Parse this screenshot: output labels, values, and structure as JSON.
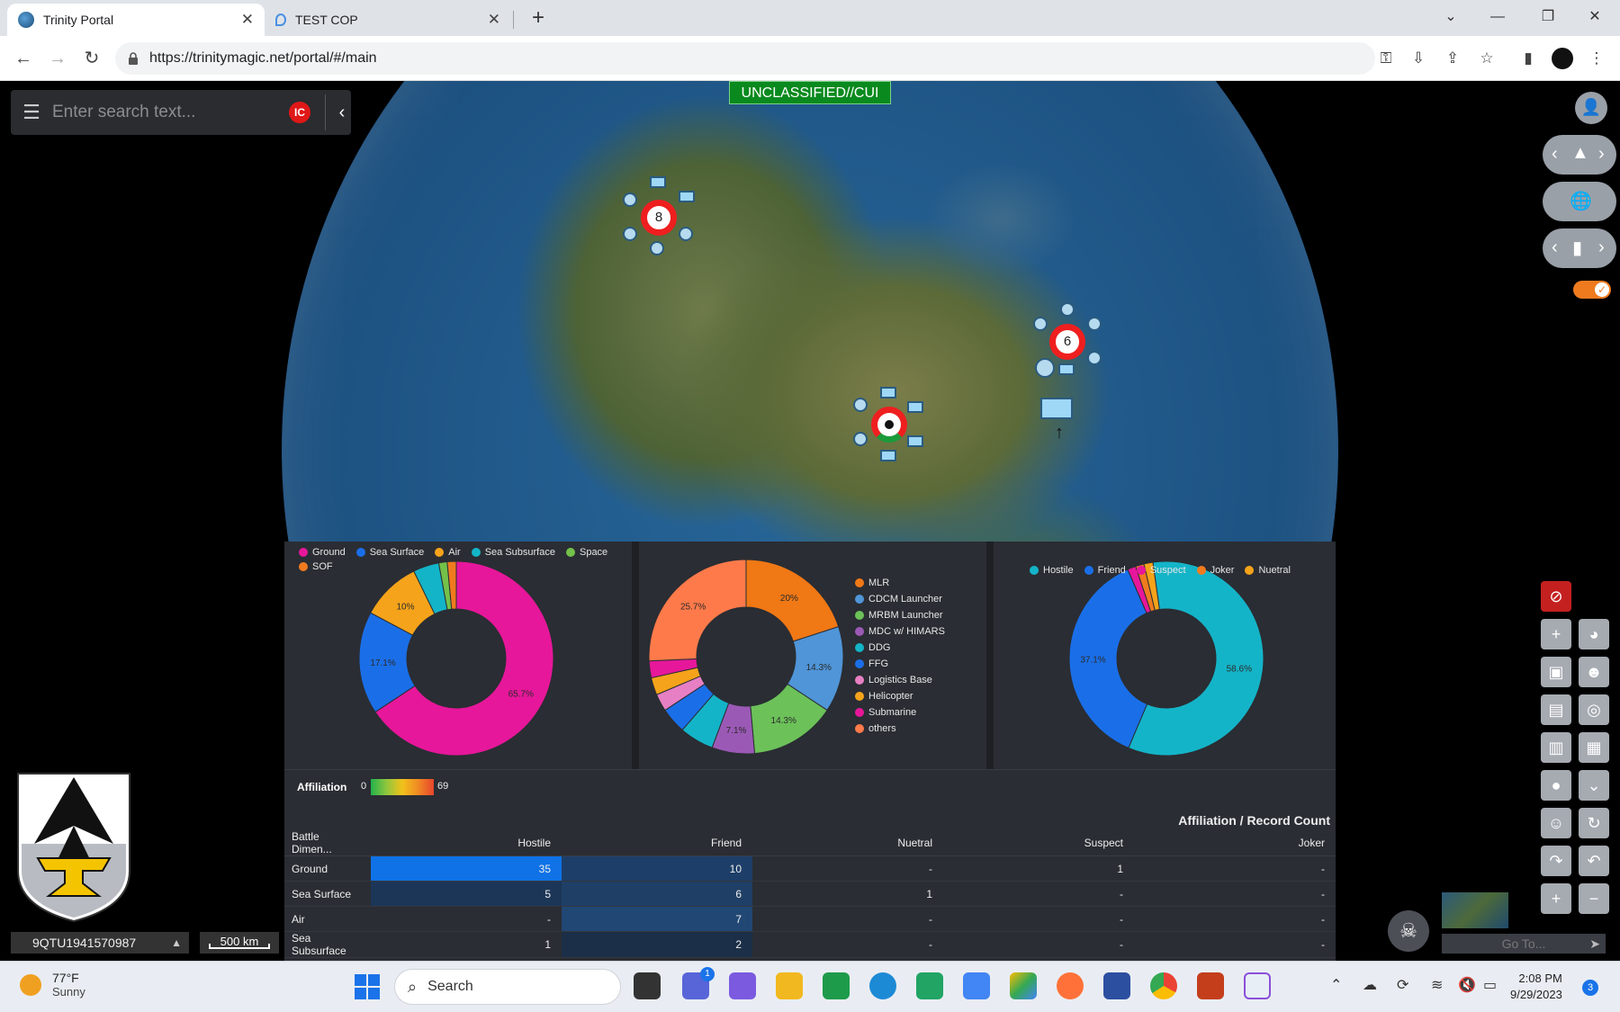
{
  "browser": {
    "tabs": [
      {
        "title": "Trinity Portal",
        "active": true
      },
      {
        "title": "TEST COP",
        "active": false
      }
    ],
    "url": "https://trinitymagic.net/portal/#/main"
  },
  "map": {
    "classification": "UNCLASSIFIED//CUI",
    "search_placeholder": "Enter search text...",
    "ic_badge": "IC",
    "clusters": [
      {
        "label": "8"
      },
      {
        "label": "6"
      }
    ],
    "coordinates": "9QTU1941570987",
    "scale": "500 km",
    "goto_placeholder": "Go To..."
  },
  "charts": {
    "dimension_legend": [
      "Ground",
      "Sea Surface",
      "Air",
      "Sea Subsurface",
      "Space",
      "SOF"
    ],
    "dimension_colors": [
      "#e6179a",
      "#1a6fe8",
      "#f5a31a",
      "#14b4c8",
      "#74c14a",
      "#f07b1f"
    ],
    "type_legend": [
      "MLR",
      "CDCM Launcher",
      "MRBM Launcher",
      "MDC w/ HIMARS",
      "DDG",
      "FFG",
      "Logistics Base",
      "Helicopter",
      "Submarine",
      "others"
    ],
    "type_colors": [
      "#f07815",
      "#4f95d8",
      "#6cc159",
      "#9b59b6",
      "#14b4c8",
      "#1a6fe8",
      "#e77fc4",
      "#f5a31a",
      "#e6179a",
      "#ff7a4a"
    ],
    "affiliation_legend": [
      "Hostile",
      "Friend",
      "Suspect",
      "Joker",
      "Nuetral"
    ],
    "affiliation_colors": [
      "#14b4c8",
      "#1a6fe8",
      "#e6179a",
      "#f07b1f",
      "#f5a31a"
    ]
  },
  "chart_data": [
    {
      "type": "pie",
      "categories": [
        "Ground",
        "Sea Surface",
        "Air",
        "Sea Subsurface",
        "Space",
        "SOF"
      ],
      "values": [
        65.7,
        17.1,
        10,
        4.3,
        1.4,
        1.5
      ],
      "labels": [
        "65.7%",
        "17.1%",
        "10%",
        "",
        "",
        ""
      ]
    },
    {
      "type": "pie",
      "categories": [
        "MLR",
        "CDCM Launcher",
        "MRBM Launcher",
        "MDC w/ HIMARS",
        "DDG",
        "FFG",
        "Logistics Base",
        "Helicopter",
        "Submarine",
        "others"
      ],
      "values": [
        20,
        14.3,
        14.3,
        7.1,
        5.7,
        4.3,
        2.9,
        2.9,
        2.8,
        25.7
      ],
      "labels": [
        "20%",
        "14.3%",
        "14.3%",
        "7.1%",
        "",
        "",
        "",
        "",
        "",
        "25.7%"
      ]
    },
    {
      "type": "pie",
      "categories": [
        "Hostile",
        "Friend",
        "Suspect",
        "Joker",
        "Nuetral"
      ],
      "values": [
        58.6,
        37.1,
        1.4,
        1.4,
        1.5
      ],
      "labels": [
        "58.6%",
        "37.1%",
        "",
        "",
        ""
      ]
    }
  ],
  "affiliation_scale": {
    "label": "Affiliation",
    "min": "0",
    "max": "69"
  },
  "table": {
    "title": "Affiliation / Record Count",
    "columns": [
      "Battle Dimen...",
      "Hostile",
      "Friend",
      "Nuetral",
      "Suspect",
      "Joker"
    ],
    "rows": [
      [
        "Ground",
        "35",
        "10",
        "-",
        "1",
        "-"
      ],
      [
        "Sea Surface",
        "5",
        "6",
        "1",
        "-",
        "-"
      ],
      [
        "Air",
        "-",
        "7",
        "-",
        "-",
        "-"
      ],
      [
        "Sea Subsurface",
        "1",
        "2",
        "-",
        "-",
        "-"
      ]
    ]
  },
  "taskbar": {
    "temperature": "77°F",
    "condition": "Sunny",
    "search_label": "Search",
    "time": "2:08 PM",
    "date": "9/29/2023",
    "notification_count": "3",
    "chat_badge": "1"
  }
}
